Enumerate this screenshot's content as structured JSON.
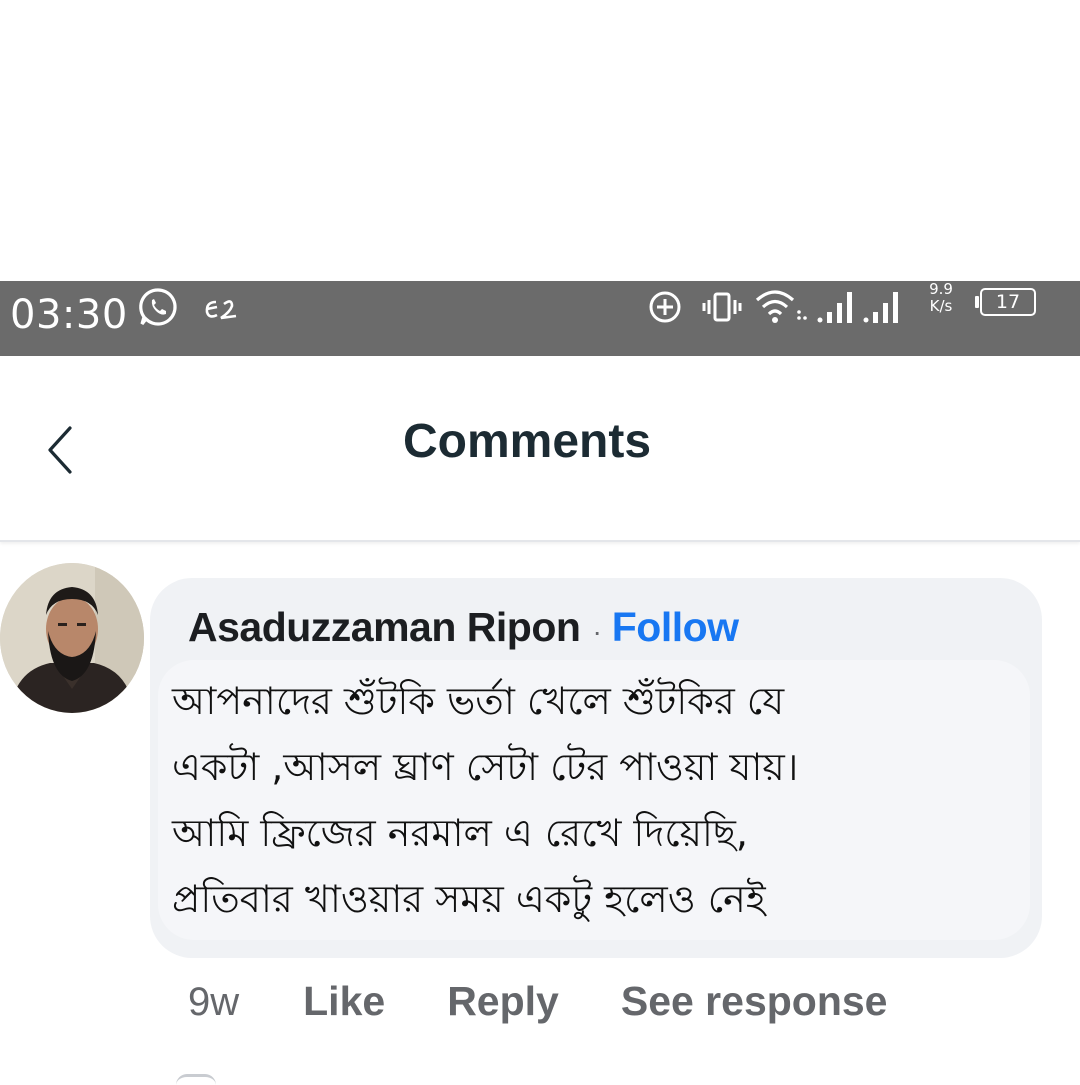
{
  "status_bar": {
    "time": "03:30",
    "net_speed_value": "9.9",
    "net_speed_unit": "K/s",
    "battery": "17",
    "icons": [
      "whatsapp-icon",
      "app-notification-icon",
      "data-saver-icon",
      "vibrate-icon",
      "wifi-icon",
      "signal-icon",
      "signal-icon"
    ]
  },
  "header": {
    "title": "Comments",
    "back_icon": "chevron-left-icon"
  },
  "comment": {
    "author": "Asaduzzaman Ripon",
    "separator": "·",
    "follow_label": "Follow",
    "text_lines": [
      "আপনাদের শুঁটকি ভর্তা খেলে শুঁটকির যে",
      "একটা ,আসল ঘ্রাণ সেটা টের পাওয়া যায়।",
      "আমি ফ্রিজের নরমাল এ রেখে দিয়েছি,",
      "প্রতিবার খাওয়ার সময় একটু হলেও নেই"
    ],
    "time_ago": "9w",
    "like_label": "Like",
    "reply_label": "Reply",
    "see_response_label": "See response"
  },
  "colors": {
    "status_bar_bg": "#6b6b6b",
    "bubble_bg": "#f0f2f5",
    "follow_blue": "#1877f2",
    "secondary_text": "#65676b",
    "title_text": "#1c2b33"
  }
}
